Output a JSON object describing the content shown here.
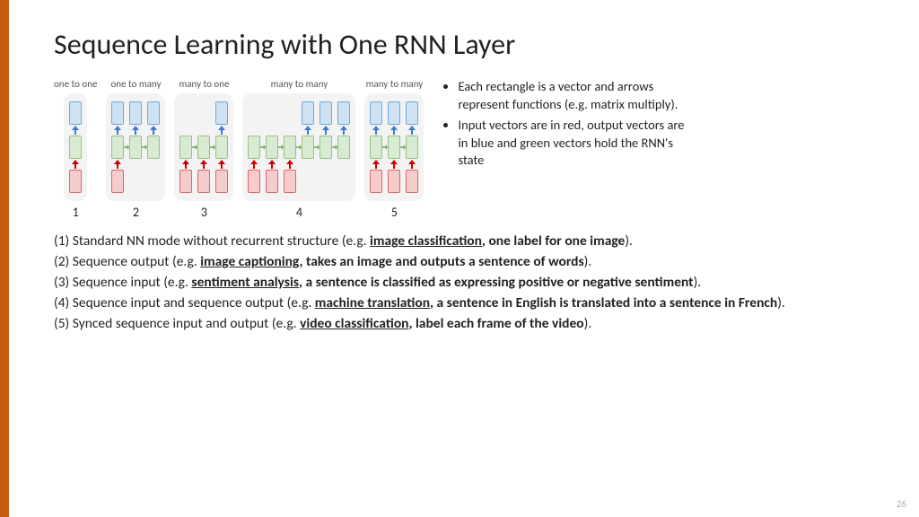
{
  "title": "Sequence Learning with One RNN Layer",
  "page_number": "26",
  "diagrams": [
    {
      "label": "one to one",
      "num": "1"
    },
    {
      "label": "one to many",
      "num": "2"
    },
    {
      "label": "many to one",
      "num": "3"
    },
    {
      "label": "many to many",
      "num": "4"
    },
    {
      "label": "many to many",
      "num": "5"
    }
  ],
  "side_notes": [
    "Each rectangle is a vector and arrows represent functions (e.g. matrix multiply).",
    "Input vectors are in red, output vectors are in blue and green vectors hold the RNN's state"
  ],
  "body": {
    "l1_a": "(1) Standard NN mode without recurrent structure (e.g. ",
    "l1_u": "image classification",
    "l1_b": ", one label for one image",
    "l1_c": ").",
    "l2_a": "(2) Sequence output (e.g. ",
    "l2_u": "image captioning",
    "l2_b": ", takes an image and outputs a sentence of words",
    "l2_c": ").",
    "l3_a": "(3) Sequence input (e.g. ",
    "l3_u": "sentiment analysis",
    "l3_b": ", a sentence is classified as expressing positive or negative sentiment",
    "l3_c": ").",
    "l4_a": "(4) Sequence input and sequence output (e.g. ",
    "l4_u": "machine translation",
    "l4_b": ", a sentence in English is translated into a sentence in French",
    "l4_c": ").",
    "l5_a": "(5) Synced sequence input and output (e.g. ",
    "l5_u": "video classification",
    "l5_b": ", label each frame of the video",
    "l5_c": ")."
  },
  "colors": {
    "accent": "#c55a11",
    "blue": "#cfe2f3",
    "green": "#d9ead3",
    "red": "#f4cccc"
  }
}
